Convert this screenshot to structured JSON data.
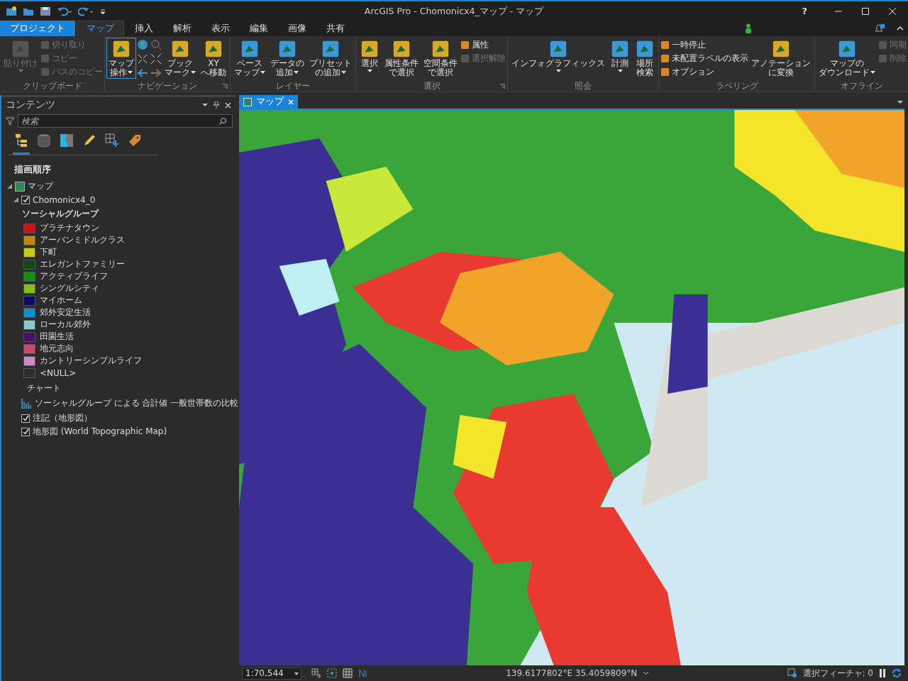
{
  "window": {
    "title": "ArcGIS Pro - Chomonicx4_マップ - マップ",
    "help": "?"
  },
  "tabs": [
    {
      "label": "プロジェクト",
      "kind": "backstage",
      "selected": false
    },
    {
      "label": "マップ",
      "kind": "tab",
      "selected": true
    },
    {
      "label": "挿入",
      "kind": "tab",
      "selected": false
    },
    {
      "label": "解析",
      "kind": "tab",
      "selected": false
    },
    {
      "label": "表示",
      "kind": "tab",
      "selected": false
    },
    {
      "label": "編集",
      "kind": "tab",
      "selected": false
    },
    {
      "label": "画像",
      "kind": "tab",
      "selected": false
    },
    {
      "label": "共有",
      "kind": "tab",
      "selected": false
    }
  ],
  "ribbon": [
    {
      "label": "クリップボード",
      "launcher": false,
      "columns": [
        {
          "kind": "large",
          "lines": [
            "貼り付け"
          ],
          "dropdown": true,
          "disabled": true,
          "selected": false
        },
        {
          "kind": "stack",
          "items": [
            {
              "label": "切り取り",
              "disabled": true
            },
            {
              "label": "コピー",
              "disabled": true
            },
            {
              "label": "パスのコピー",
              "disabled": true
            }
          ]
        }
      ]
    },
    {
      "label": "ナビゲーション",
      "launcher": true,
      "columns": [
        {
          "kind": "large",
          "lines": [
            "マップ",
            "操作"
          ],
          "dropdown": true,
          "disabled": false,
          "selected": true
        },
        {
          "kind": "nav_icons"
        },
        {
          "kind": "large",
          "lines": [
            "ブック",
            "マーク"
          ],
          "dropdown": true,
          "disabled": false,
          "selected": false
        },
        {
          "kind": "large",
          "lines": [
            "XY",
            "へ移動"
          ],
          "dropdown": false,
          "disabled": false,
          "selected": false
        }
      ]
    },
    {
      "label": "レイヤー",
      "launcher": false,
      "columns": [
        {
          "kind": "large",
          "lines": [
            "ベース",
            "マップ"
          ],
          "dropdown": true,
          "disabled": false,
          "selected": false
        },
        {
          "kind": "large",
          "lines": [
            "データの",
            "追加"
          ],
          "dropdown": true,
          "disabled": false,
          "selected": false
        },
        {
          "kind": "large",
          "lines": [
            "プリセット",
            "の追加"
          ],
          "dropdown": true,
          "disabled": false,
          "selected": false
        }
      ]
    },
    {
      "label": "選択",
      "launcher": true,
      "columns": [
        {
          "kind": "large",
          "lines": [
            "選択"
          ],
          "dropdown": true,
          "disabled": false,
          "selected": false
        },
        {
          "kind": "large",
          "lines": [
            "属性条件",
            "で選択"
          ],
          "dropdown": false,
          "disabled": false,
          "selected": false
        },
        {
          "kind": "large",
          "lines": [
            "空間条件",
            "で選択"
          ],
          "dropdown": false,
          "disabled": false,
          "selected": false
        },
        {
          "kind": "stack",
          "items": [
            {
              "label": "属性",
              "disabled": false
            },
            {
              "label": "選択解除",
              "disabled": true
            }
          ]
        }
      ]
    },
    {
      "label": "照会",
      "launcher": false,
      "columns": [
        {
          "kind": "large",
          "lines": [
            "インフォグラフィックス"
          ],
          "dropdown": true,
          "disabled": false,
          "selected": false
        },
        {
          "kind": "large",
          "lines": [
            "計測"
          ],
          "dropdown": true,
          "disabled": false,
          "selected": false
        },
        {
          "kind": "large",
          "lines": [
            "場所",
            "検索"
          ],
          "dropdown": false,
          "disabled": false,
          "selected": false
        }
      ]
    },
    {
      "label": "ラベリング",
      "launcher": false,
      "columns": [
        {
          "kind": "stack",
          "items": [
            {
              "label": "一時停止",
              "disabled": false
            },
            {
              "label": "未配置ラベルの表示",
              "disabled": false
            },
            {
              "label": "オプション",
              "disabled": false
            }
          ]
        },
        {
          "kind": "large",
          "lines": [
            "アノテーション",
            "に変換"
          ],
          "dropdown": false,
          "disabled": false,
          "selected": false
        }
      ]
    },
    {
      "label": "オフライン",
      "launcher": false,
      "columns": [
        {
          "kind": "large",
          "lines": [
            "マップの",
            "ダウンロード"
          ],
          "dropdown": true,
          "disabled": false,
          "selected": false
        },
        {
          "kind": "stack",
          "items": [
            {
              "label": "同期",
              "disabled": true
            },
            {
              "label": "削除",
              "disabled": true
            }
          ]
        }
      ]
    }
  ],
  "contents": {
    "title": "コンテンツ",
    "search": {
      "placeholder": "検索"
    },
    "views": [
      {
        "kind": "draw_order",
        "selected": true
      },
      {
        "kind": "source",
        "selected": false
      },
      {
        "kind": "selection",
        "selected": false
      },
      {
        "kind": "editing",
        "selected": false
      },
      {
        "kind": "snapping",
        "selected": false
      },
      {
        "kind": "labeling",
        "selected": false
      }
    ],
    "heading": "描画順序",
    "map": {
      "label": "マップ",
      "expanded": true,
      "layers": [
        {
          "label": "Chomonicx4_0",
          "checked": true,
          "expanded": true,
          "legend_title": "ソーシャルグループ",
          "legend": [
            {
              "label": "プラチナタウン",
              "color": "#c81414"
            },
            {
              "label": "アーバンミドルクラス",
              "color": "#c8860e"
            },
            {
              "label": "下町",
              "color": "#c8c814"
            },
            {
              "label": "エレガントファミリー",
              "color": "#0f4a0f"
            },
            {
              "label": "アクティブライフ",
              "color": "#128c12"
            },
            {
              "label": "シングルシティ",
              "color": "#82c314"
            },
            {
              "label": "マイホーム",
              "color": "#0c0c64"
            },
            {
              "label": "郊外安定生活",
              "color": "#148cc8"
            },
            {
              "label": "ローカル郊外",
              "color": "#8cc8c8"
            },
            {
              "label": "田園生活",
              "color": "#4a0f6e"
            },
            {
              "label": "地元志向",
              "color": "#c84a6e"
            },
            {
              "label": "カントリーシンプルライフ",
              "color": "#c88cc8"
            },
            {
              "label": "<NULL>",
              "color": "#2d2d2d"
            }
          ],
          "chart_title": "チャート",
          "chart_label": "ソーシャルグループ による 合計値 一般世帯数の比較"
        },
        {
          "label": "注記（地形図）",
          "checked": true,
          "expanded": false
        },
        {
          "label": "地形図 (World Topographic Map)",
          "checked": true,
          "expanded": false
        }
      ]
    }
  },
  "map_tab": {
    "label": "マップ",
    "selected": true
  },
  "status_bar": {
    "scale": "1:70,544",
    "coordinates": "139.6177802°E 35.4059809°N",
    "selected_features": "選択フィーチャ: 0"
  }
}
